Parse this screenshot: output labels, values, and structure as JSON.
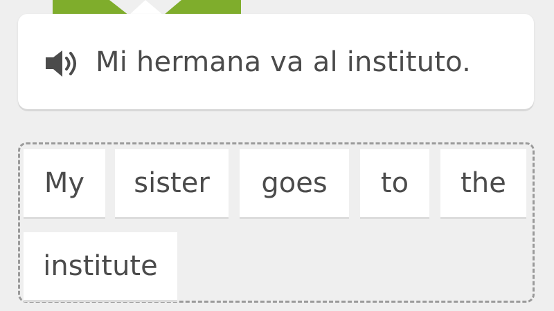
{
  "prompt": {
    "sentence": "Mi hermana va al instituto.",
    "speaker_icon": "speaker-icon"
  },
  "answer": {
    "words": [
      "My",
      "sister",
      "goes",
      "to",
      "the",
      "institute"
    ]
  },
  "colors": {
    "mascot_green": "#7fad2c",
    "background": "#efefef",
    "text": "#4b4b4b",
    "dash_border": "#9a9a9a"
  }
}
